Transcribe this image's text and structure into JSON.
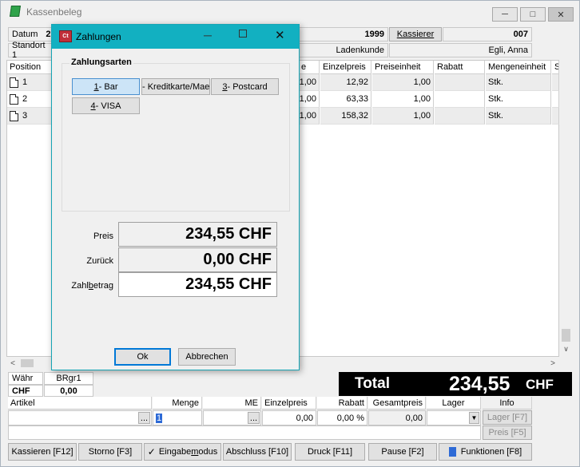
{
  "window": {
    "title": "Kassenbeleg",
    "minimize": "─",
    "maximize": "□",
    "close": "✕"
  },
  "header": {
    "datum_label": "Datum",
    "datum_value": "2",
    "year": "1999",
    "kassierer_button": "Kassierer",
    "kassierer_value": "007",
    "standort_label": "Standort 1",
    "ladenkunde": "Ladenkunde",
    "customer": "Egli, Anna"
  },
  "grid": {
    "columns": [
      "Position",
      "e",
      "Einzelpreis",
      "Preiseinheit",
      "Rabatt",
      "Mengeneinheit",
      "S"
    ],
    "rows": [
      {
        "pos": "1",
        "menge": "1,00",
        "einzelpreis": "12,92",
        "preiseinheit": "1,00",
        "rabatt": "",
        "einheit": "Stk."
      },
      {
        "pos": "2",
        "menge": "1,00",
        "einzelpreis": "63,33",
        "preiseinheit": "1,00",
        "rabatt": "",
        "einheit": "Stk."
      },
      {
        "pos": "3",
        "menge": "1,00",
        "einzelpreis": "158,32",
        "preiseinheit": "1,00",
        "rabatt": "",
        "einheit": "Stk."
      }
    ]
  },
  "dialog": {
    "title": "Zahlungen",
    "group_title": "Zahlungsarten",
    "payment_methods": [
      {
        "num": "1",
        "label": " - Bar"
      },
      {
        "num": "",
        "label": "- Kreditkarte/Maestro"
      },
      {
        "num": "3",
        "label": " - Postcard"
      },
      {
        "num": "4",
        "label": " - VISA"
      }
    ],
    "preis_label": "Preis",
    "preis_value": "234,55 CHF",
    "zurueck_label": "Zurück",
    "zurueck_value": "0,00 CHF",
    "zahlbetrag_label_a": "Zahl",
    "zahlbetrag_label_b": "b",
    "zahlbetrag_label_c": "etrag",
    "zahlbetrag_value": "234,55 CHF",
    "ok": "Ok",
    "cancel": "Abbrechen"
  },
  "summary": {
    "waehr_label": "Währ",
    "waehr_value": "BRgr1",
    "currency": "CHF",
    "amount": "0,00",
    "total_label": "Total",
    "total_value": "234,55",
    "total_currency": "CHF",
    "info_label": "Info"
  },
  "entry": {
    "headers": {
      "artikel": "Artikel",
      "menge": "Menge",
      "me": "ME",
      "einzelpreis": "Einzelpreis",
      "rabatt": "Rabatt",
      "gesamtpreis": "Gesamtpreis",
      "lager": "Lager"
    },
    "menge_value": "1",
    "einzelpreis_value": "0,00",
    "rabatt_value": "0,00 %",
    "gesamtpreis_value": "0,00",
    "lager_button": "Lager [F7]",
    "preis_button": "Preis [F5]"
  },
  "footer": {
    "kassieren": "Kassieren [F12]",
    "storno": "Storno [F3]",
    "eingabemodus_a": "Eingabe",
    "eingabemodus_b": "m",
    "eingabemodus_c": "odus",
    "abschluss": "Abschluss [F10]",
    "druck": "Druck [F11]",
    "pause": "Pause [F2]",
    "funktionen": "Funktionen [F8]"
  },
  "colors": {
    "dialog_title": "#12b0c1",
    "total_bg": "#000000",
    "selected_chip": "#cce4f7"
  }
}
